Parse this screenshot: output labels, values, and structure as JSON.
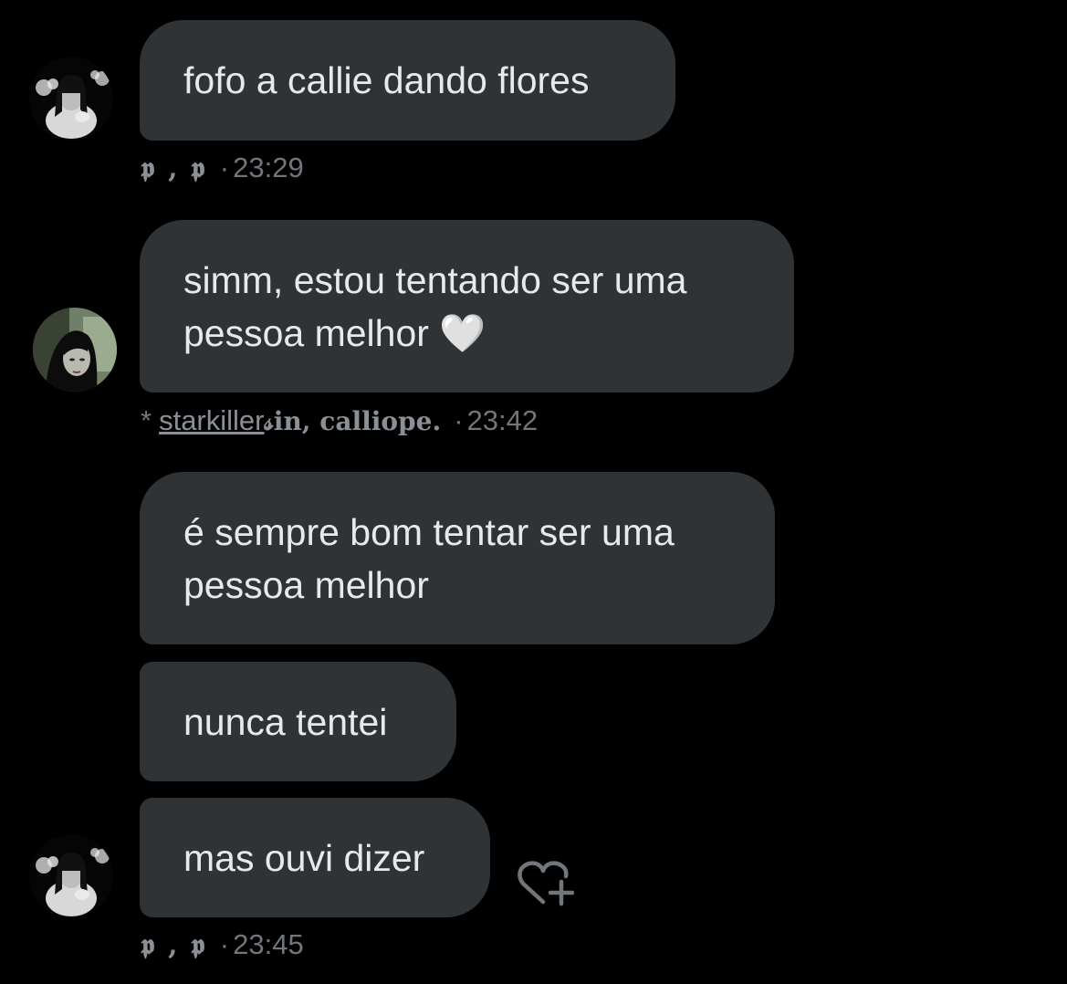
{
  "colors": {
    "background": "#000000",
    "bubble": "#2f3336",
    "text": "#e7e9ea",
    "meta": "#71767b"
  },
  "messages": [
    {
      "text": "fofo a callie dando flores"
    },
    {
      "text": "simm, estou tentando ser uma\npessoa melhor 🤍"
    },
    {
      "text": "é sempre bom tentar ser uma\npessoa melhor"
    },
    {
      "text": "nunca tentei"
    },
    {
      "text": "mas ouvi dizer"
    }
  ],
  "meta": [
    {
      "sender": "𝖕 , 𝖕",
      "sep": "·",
      "time": "23:29"
    },
    {
      "prefix": "*",
      "sender_link": "starkiller",
      "sender_rest": " 𝓈in, calliope.",
      "sep": "·",
      "time": "23:42"
    },
    {
      "sender": "𝖕 , 𝖕",
      "sep": "·",
      "time": "23:45"
    }
  ],
  "icons": {
    "avatar_a": "avatar-dark-haired-woman",
    "avatar_b": "avatar-woman-green-background",
    "reaction": "add-reaction-heart-icon"
  }
}
